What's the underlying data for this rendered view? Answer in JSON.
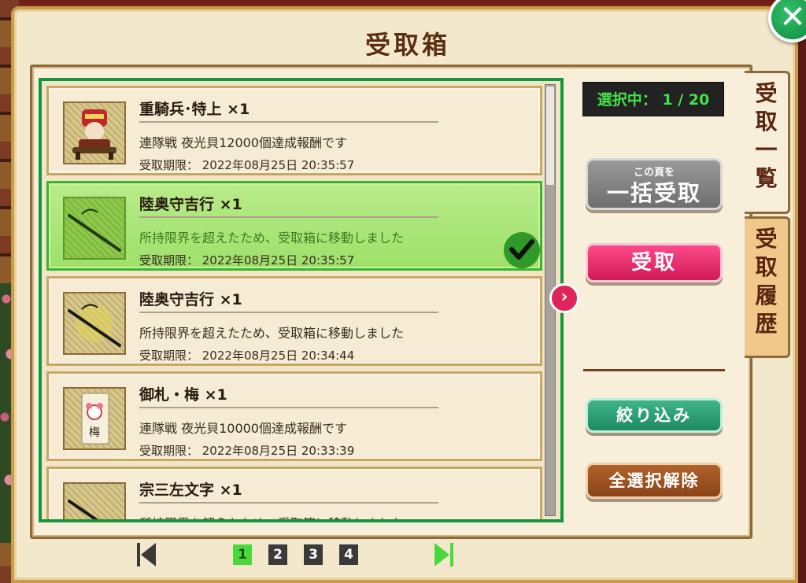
{
  "title": "受取箱",
  "counter": "選択中： 1 / 20",
  "buttons": {
    "bulk_sub": "この頁を",
    "bulk_main": "一括受取",
    "receive": "受取",
    "filter": "絞り込み",
    "deselect": "全選択解除"
  },
  "tabs": {
    "list": [
      "受",
      "取",
      "一",
      "覧"
    ],
    "history": [
      "受",
      "取",
      "履",
      "歴"
    ]
  },
  "items": [
    {
      "name": "重騎兵･特上 ×1",
      "desc": "連隊戦 夜光貝12000個達成報酬です",
      "expiry": "受取期限： 2022年08月25日 20:35:57",
      "selected": false,
      "icon": "warrior-icon"
    },
    {
      "name": "陸奥守吉行 ×1",
      "desc": "所持限界を超えたため、受取箱に移動しました",
      "expiry": "受取期限： 2022年08月25日 20:35:57",
      "selected": true,
      "icon": "sword-icon"
    },
    {
      "name": "陸奥守吉行 ×1",
      "desc": "所持限界を超えたため、受取箱に移動しました",
      "expiry": "受取期限： 2022年08月25日 20:34:44",
      "selected": false,
      "icon": "sword-icon"
    },
    {
      "name": "御札・梅 ×1",
      "desc": "連隊戦 夜光貝10000個達成報酬です",
      "expiry": "受取期限： 2022年08月25日 20:33:39",
      "selected": false,
      "icon": "talisman-icon"
    },
    {
      "name": "宗三左文字 ×1",
      "desc": "所持限界を超えたため、受取箱に移動しました",
      "expiry": "",
      "selected": false,
      "icon": "sword-icon"
    }
  ],
  "talisman_text": "梅",
  "pagination": {
    "pages": [
      "1",
      "2",
      "3",
      "4"
    ],
    "current": "1"
  },
  "colors": {
    "list_border": "#16963c",
    "selected": "#9ee06a",
    "receive": "#e0245a"
  }
}
